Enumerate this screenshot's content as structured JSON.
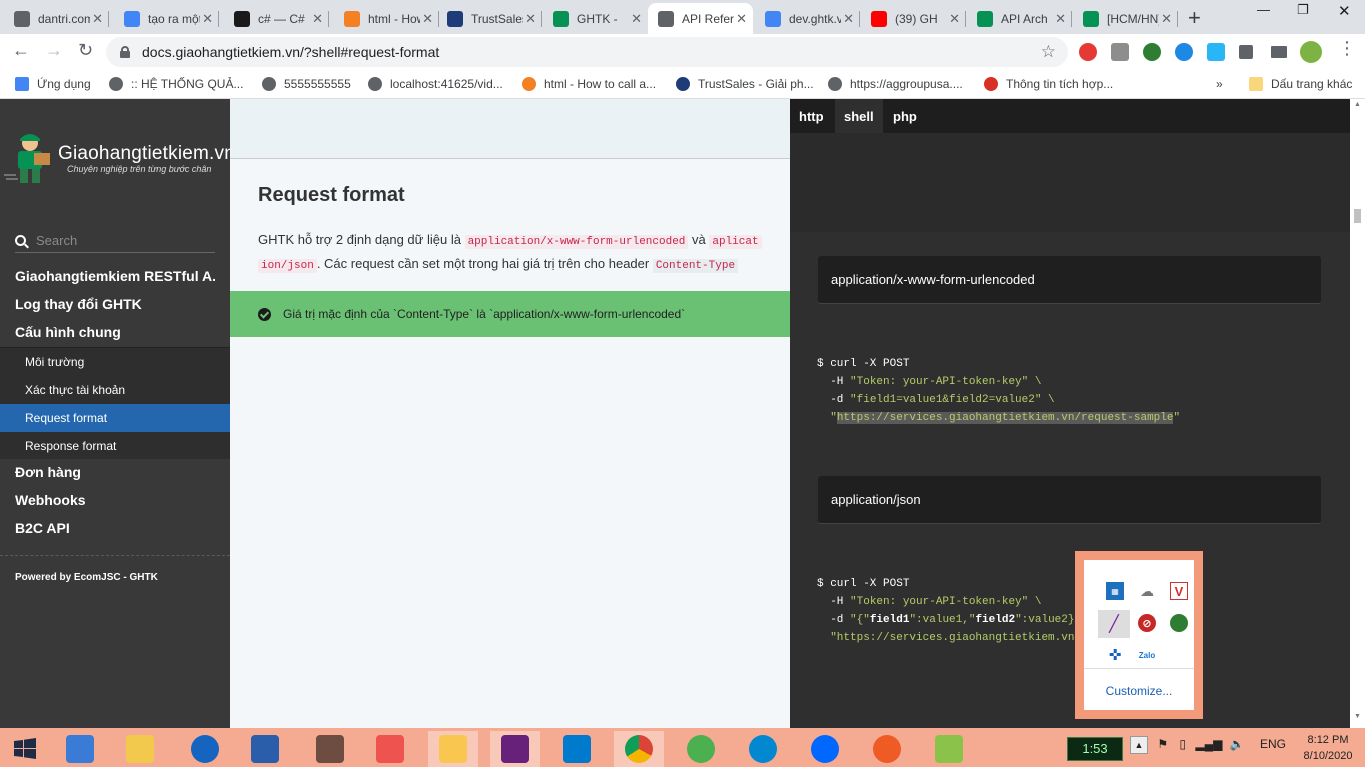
{
  "browser": {
    "tabs": [
      {
        "title": "dantri.com",
        "icon": "globe-icon",
        "color": "#5f6368"
      },
      {
        "title": "tạo ra một",
        "icon": "google-icon",
        "color": "#4285f4"
      },
      {
        "title": "c# — C#",
        "icon": "resharper-icon",
        "color": "#1a1a1a"
      },
      {
        "title": "html - How",
        "icon": "stackoverflow-icon",
        "color": "#f48024"
      },
      {
        "title": "TrustSales",
        "icon": "trust-icon",
        "color": "#1d3c78"
      },
      {
        "title": "GHTK - ",
        "icon": "ghtk-icon",
        "color": "#069255"
      },
      {
        "title": "API Refere",
        "icon": "globe-icon",
        "color": "#5f6368"
      },
      {
        "title": "dev.ghtk.vn",
        "icon": "google-icon",
        "color": "#4285f4"
      },
      {
        "title": "(39) GH",
        "icon": "youtube-icon",
        "color": "#ff0000"
      },
      {
        "title": "API Arch",
        "icon": "ghtk-icon",
        "color": "#069255"
      },
      {
        "title": "[HCM/HN]",
        "icon": "ghtk-icon",
        "color": "#069255"
      }
    ],
    "active_tab": 6,
    "url": "docs.giaohangtietkiem.vn/?shell#request-format",
    "bookmarks": [
      {
        "label": "Ứng dụng",
        "icon": "apps-grid-icon"
      },
      {
        "label": ":: HỆ THỐNG QUẢ...",
        "icon": "globe-icon"
      },
      {
        "label": "5555555555",
        "icon": "globe-icon"
      },
      {
        "label": "localhost:41625/vid...",
        "icon": "globe-icon"
      },
      {
        "label": "html - How to call a...",
        "icon": "stackoverflow-icon"
      },
      {
        "label": "TrustSales - Giải ph...",
        "icon": "trust-icon"
      },
      {
        "label": "https://aggroupusa....",
        "icon": "globe-icon"
      },
      {
        "label": "Thông tin tích hợp...",
        "icon": "gmail-icon"
      }
    ],
    "other_bookmarks": "Dấu trang khác",
    "more_bookmarks": "»"
  },
  "sidebar": {
    "logo_text": "Giaohangtietkiem.vn",
    "logo_tagline": "Chuyên nghiệp trên từng bước chân",
    "search_placeholder": "Search",
    "toc": [
      {
        "label": "Giaohangtiemkiem RESTful A..."
      },
      {
        "label": "Log thay đổi GHTK"
      },
      {
        "label": "Cấu hình chung"
      }
    ],
    "sub_items": [
      {
        "label": "Môi trường"
      },
      {
        "label": "Xác thực tài khoản"
      },
      {
        "label": "Request format",
        "active": true
      },
      {
        "label": "Response format"
      }
    ],
    "toc_after": [
      {
        "label": "Đơn hàng"
      },
      {
        "label": "Webhooks"
      },
      {
        "label": "B2C API"
      }
    ],
    "powered_by": "Powered by EcomJSC - GHTK"
  },
  "content": {
    "heading": "Request format",
    "para_1": "GHTK hỗ trợ 2 định dạng dữ liệu là ",
    "code_1": "application/x-www-form-urlencoded",
    "para_2": " và ",
    "code_2a": "aplicat",
    "code_2b": "ion/json",
    "para_3": ". Các request cần set một trong hai giá trị trên cho header ",
    "code_3": "Content-Type",
    "notice": "Giá trị mặc định của `Content-Type` là `application/x-www-form-urlencoded`"
  },
  "code_panel": {
    "languages": [
      "http",
      "shell",
      "php"
    ],
    "active_language": "shell",
    "block_1_label": "application/x-www-form-urlencoded",
    "block_2_label": "application/json",
    "snippet_1": {
      "l1": "$ curl -X POST",
      "l2a": "  -H ",
      "l2s": "\"Token: your-API-token-key\"",
      "l2e": " \\",
      "l3a": "  -d ",
      "l3s": "\"field1=value1&field2=value2\"",
      "l3e": " \\",
      "l4a": "  \"",
      "l4sel": "https://services.giaohangtietkiem.vn/request-sample",
      "l4e": "\""
    },
    "snippet_2": {
      "l1": "$ curl -X POST",
      "l2a": "  -H ",
      "l2s": "\"Token: your-API-token-key\"",
      "l2e": " \\",
      "l3a": "  -d ",
      "l3s1": "\"{\"",
      "l3b1": "field1",
      "l3s2": "\":value1,\"",
      "l3b2": "field2",
      "l3s3": "\":value2}",
      "l4a": "  ",
      "l4s": "\"https://services.giaohangtietkiem.vn"
    }
  },
  "tray_flyout": {
    "customize": "Customize..."
  },
  "taskbar": {
    "clock_widget": "1:53",
    "language": "ENG",
    "time": "8:12 PM",
    "date": "8/10/2020"
  },
  "colors": {
    "sidebar_bg": "#393939",
    "active_item": "#2467af",
    "notice_green": "#6ac174",
    "code_bg": "#2f2f2f",
    "taskbar": "#f4ab92"
  }
}
